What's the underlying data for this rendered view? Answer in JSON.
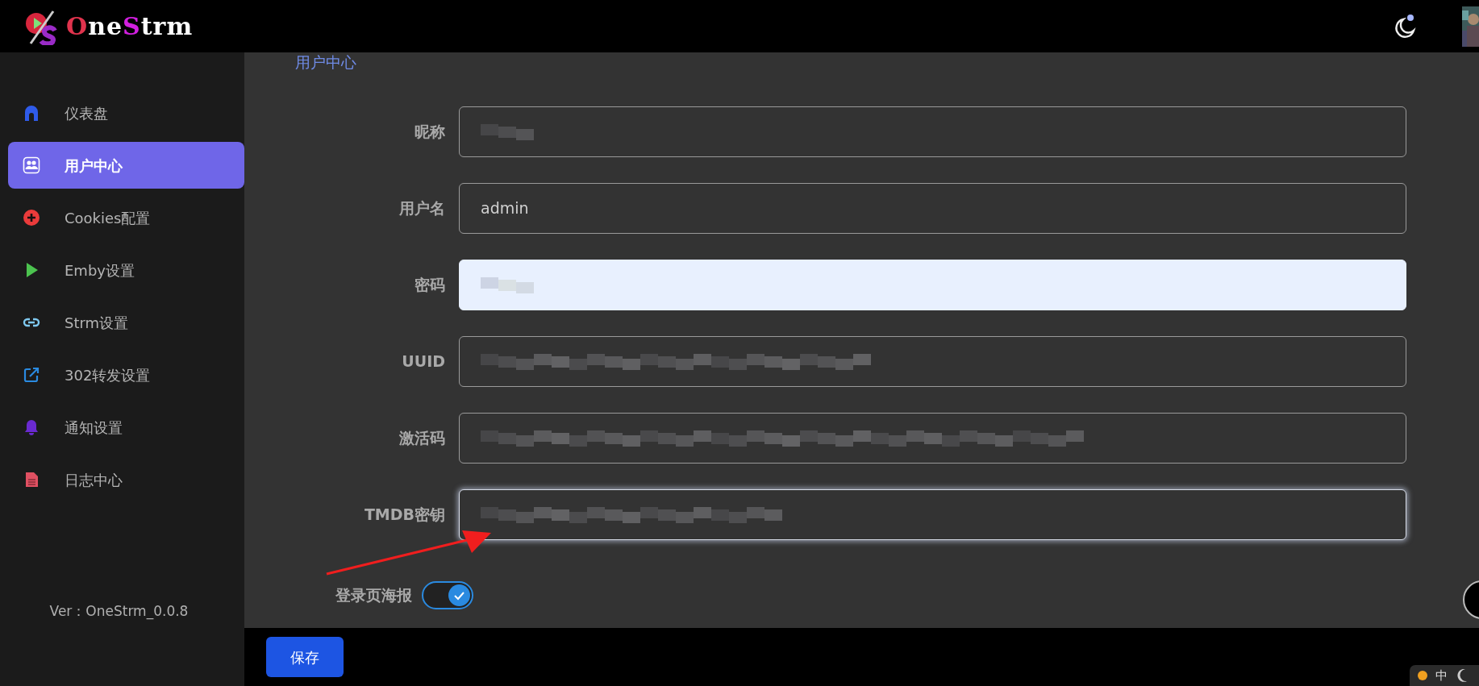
{
  "header": {
    "logo": [
      {
        "text": "O",
        "color": "#e0334d"
      },
      {
        "text": "ne",
        "color": "#ffffff"
      },
      {
        "text": "S",
        "color": "#d21fe0"
      },
      {
        "text": "trm",
        "color": "#ffffff"
      }
    ]
  },
  "sidebar": {
    "items": [
      {
        "label": "仪表盘",
        "kind": "home",
        "color": "#2f5bea",
        "selected": false
      },
      {
        "label": "用户中心",
        "kind": "users",
        "color": "#ffffff",
        "selected": true
      },
      {
        "label": "Cookies配置",
        "kind": "plus",
        "color": "#ea3b3b",
        "selected": false
      },
      {
        "label": "Emby设置",
        "kind": "play",
        "color": "#4cc34f",
        "selected": false
      },
      {
        "label": "Strm设置",
        "kind": "link",
        "color": "#7fc9f0",
        "selected": false
      },
      {
        "label": "302转发设置",
        "kind": "external",
        "color": "#2a8ae0",
        "selected": false
      },
      {
        "label": "通知设置",
        "kind": "bell",
        "color": "#6a2ad0",
        "selected": false
      },
      {
        "label": "日志中心",
        "kind": "file",
        "color": "#e05062",
        "selected": false
      }
    ],
    "version": "Ver：OneStrm_0.0.8"
  },
  "page_title": "用户中心",
  "form": {
    "fields": [
      {
        "label": "昵称",
        "redacted": true,
        "autofilled": false,
        "focused": false
      },
      {
        "label": "用户名",
        "value": "admin",
        "redacted": false,
        "autofilled": false,
        "focused": false
      },
      {
        "label": "密码",
        "redacted": true,
        "autofilled": true,
        "focused": false
      },
      {
        "label": "UUID",
        "redacted": true,
        "autofilled": false,
        "focused": false
      },
      {
        "label": "激活码",
        "redacted": true,
        "autofilled": false,
        "focused": false
      },
      {
        "label": "TMDB密钥",
        "redacted": true,
        "autofilled": false,
        "focused": true
      }
    ],
    "toggle": {
      "label": "登录页海报",
      "on": true
    }
  },
  "save_button": "保存",
  "ime_tray": {
    "mode": "中"
  }
}
